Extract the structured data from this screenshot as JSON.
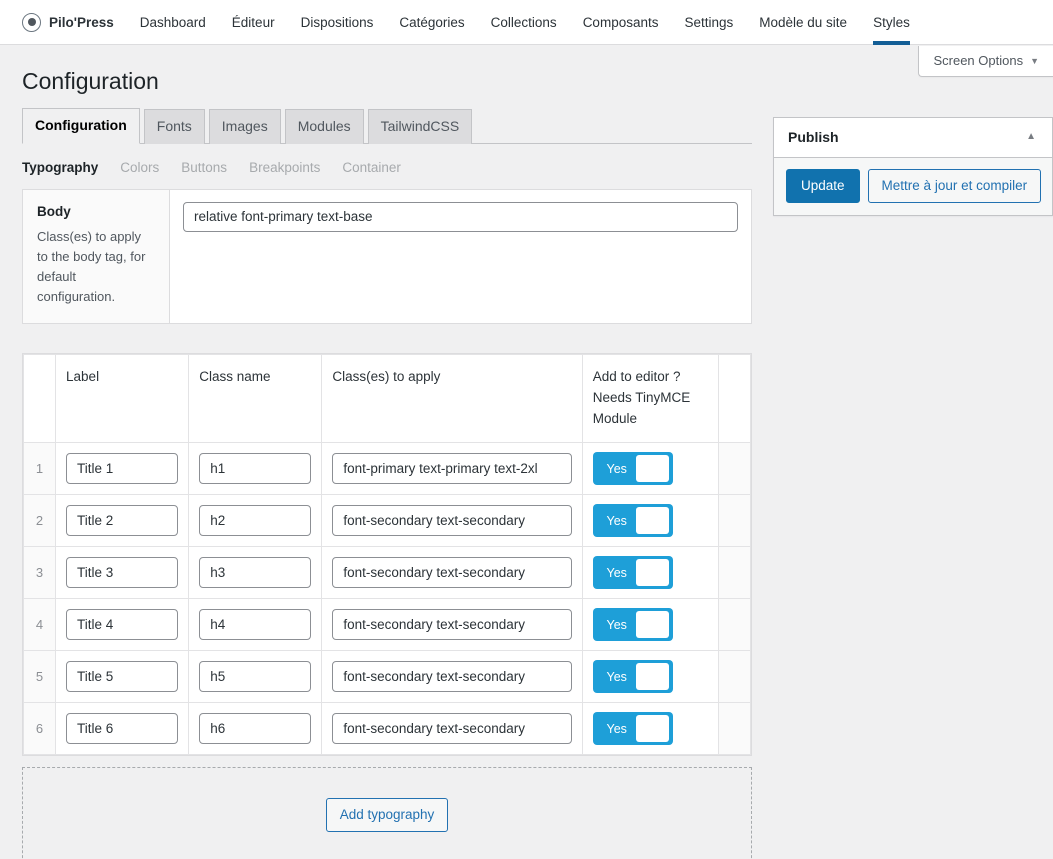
{
  "adminbar": {
    "brand": "Pilo'Press",
    "brand_icon": "target-circle-icon",
    "items": [
      {
        "label": "Dashboard",
        "active": false
      },
      {
        "label": "Éditeur",
        "active": false
      },
      {
        "label": "Dispositions",
        "active": false
      },
      {
        "label": "Catégories",
        "active": false
      },
      {
        "label": "Collections",
        "active": false
      },
      {
        "label": "Composants",
        "active": false
      },
      {
        "label": "Settings",
        "active": false
      },
      {
        "label": "Modèle du site",
        "active": false
      },
      {
        "label": "Styles",
        "active": true
      }
    ],
    "active_underline_color": "#135e96"
  },
  "screen_options": {
    "label": "Screen Options",
    "caret": "▼"
  },
  "page": {
    "title": "Configuration"
  },
  "tabs": [
    {
      "label": "Configuration",
      "active": true
    },
    {
      "label": "Fonts",
      "active": false
    },
    {
      "label": "Images",
      "active": false
    },
    {
      "label": "Modules",
      "active": false
    },
    {
      "label": "TailwindCSS",
      "active": false
    }
  ],
  "subtabs": [
    {
      "label": "Typography",
      "active": true
    },
    {
      "label": "Colors",
      "active": false
    },
    {
      "label": "Buttons",
      "active": false
    },
    {
      "label": "Breakpoints",
      "active": false
    },
    {
      "label": "Container",
      "active": false
    }
  ],
  "body_panel": {
    "title": "Body",
    "description": "Class(es) to apply to the body tag, for default configuration.",
    "field_value": "relative font-primary text-base",
    "field_placeholder": ""
  },
  "table": {
    "headers": {
      "order": "",
      "label": "Label",
      "class_name": "Class name",
      "classes_to_apply": "Class(es) to apply",
      "add_to_editor_line1": "Add to editor ?",
      "add_to_editor_line2": "Needs TinyMCE",
      "add_to_editor_line3": "Module",
      "actions": ""
    },
    "rows": [
      {
        "order": "1",
        "label": "Title 1",
        "class_name": "h1",
        "classes": "font-primary text-primary text-2xl",
        "editor": "Yes"
      },
      {
        "order": "2",
        "label": "Title 2",
        "class_name": "h2",
        "classes": "font-secondary text-secondary",
        "editor": "Yes"
      },
      {
        "order": "3",
        "label": "Title 3",
        "class_name": "h3",
        "classes": "font-secondary text-secondary",
        "editor": "Yes"
      },
      {
        "order": "4",
        "label": "Title 4",
        "class_name": "h4",
        "classes": "font-secondary text-secondary",
        "editor": "Yes"
      },
      {
        "order": "5",
        "label": "Title 5",
        "class_name": "h5",
        "classes": "font-secondary text-secondary",
        "editor": "Yes"
      },
      {
        "order": "6",
        "label": "Title 6",
        "class_name": "h6",
        "classes": "font-secondary text-secondary",
        "editor": "Yes"
      }
    ]
  },
  "add_typography": {
    "label": "Add typography"
  },
  "publish": {
    "title": "Publish",
    "collapse_indicator": "▲",
    "update_label": "Update",
    "compile_label": "Mettre à jour et compiler"
  },
  "colors": {
    "primary_button": "#1172ae",
    "secondary_button_border": "#2271b1",
    "toggle_on": "#1e9fd8",
    "active_nav_underline": "#135e96",
    "page_background": "#f0f0f1"
  }
}
